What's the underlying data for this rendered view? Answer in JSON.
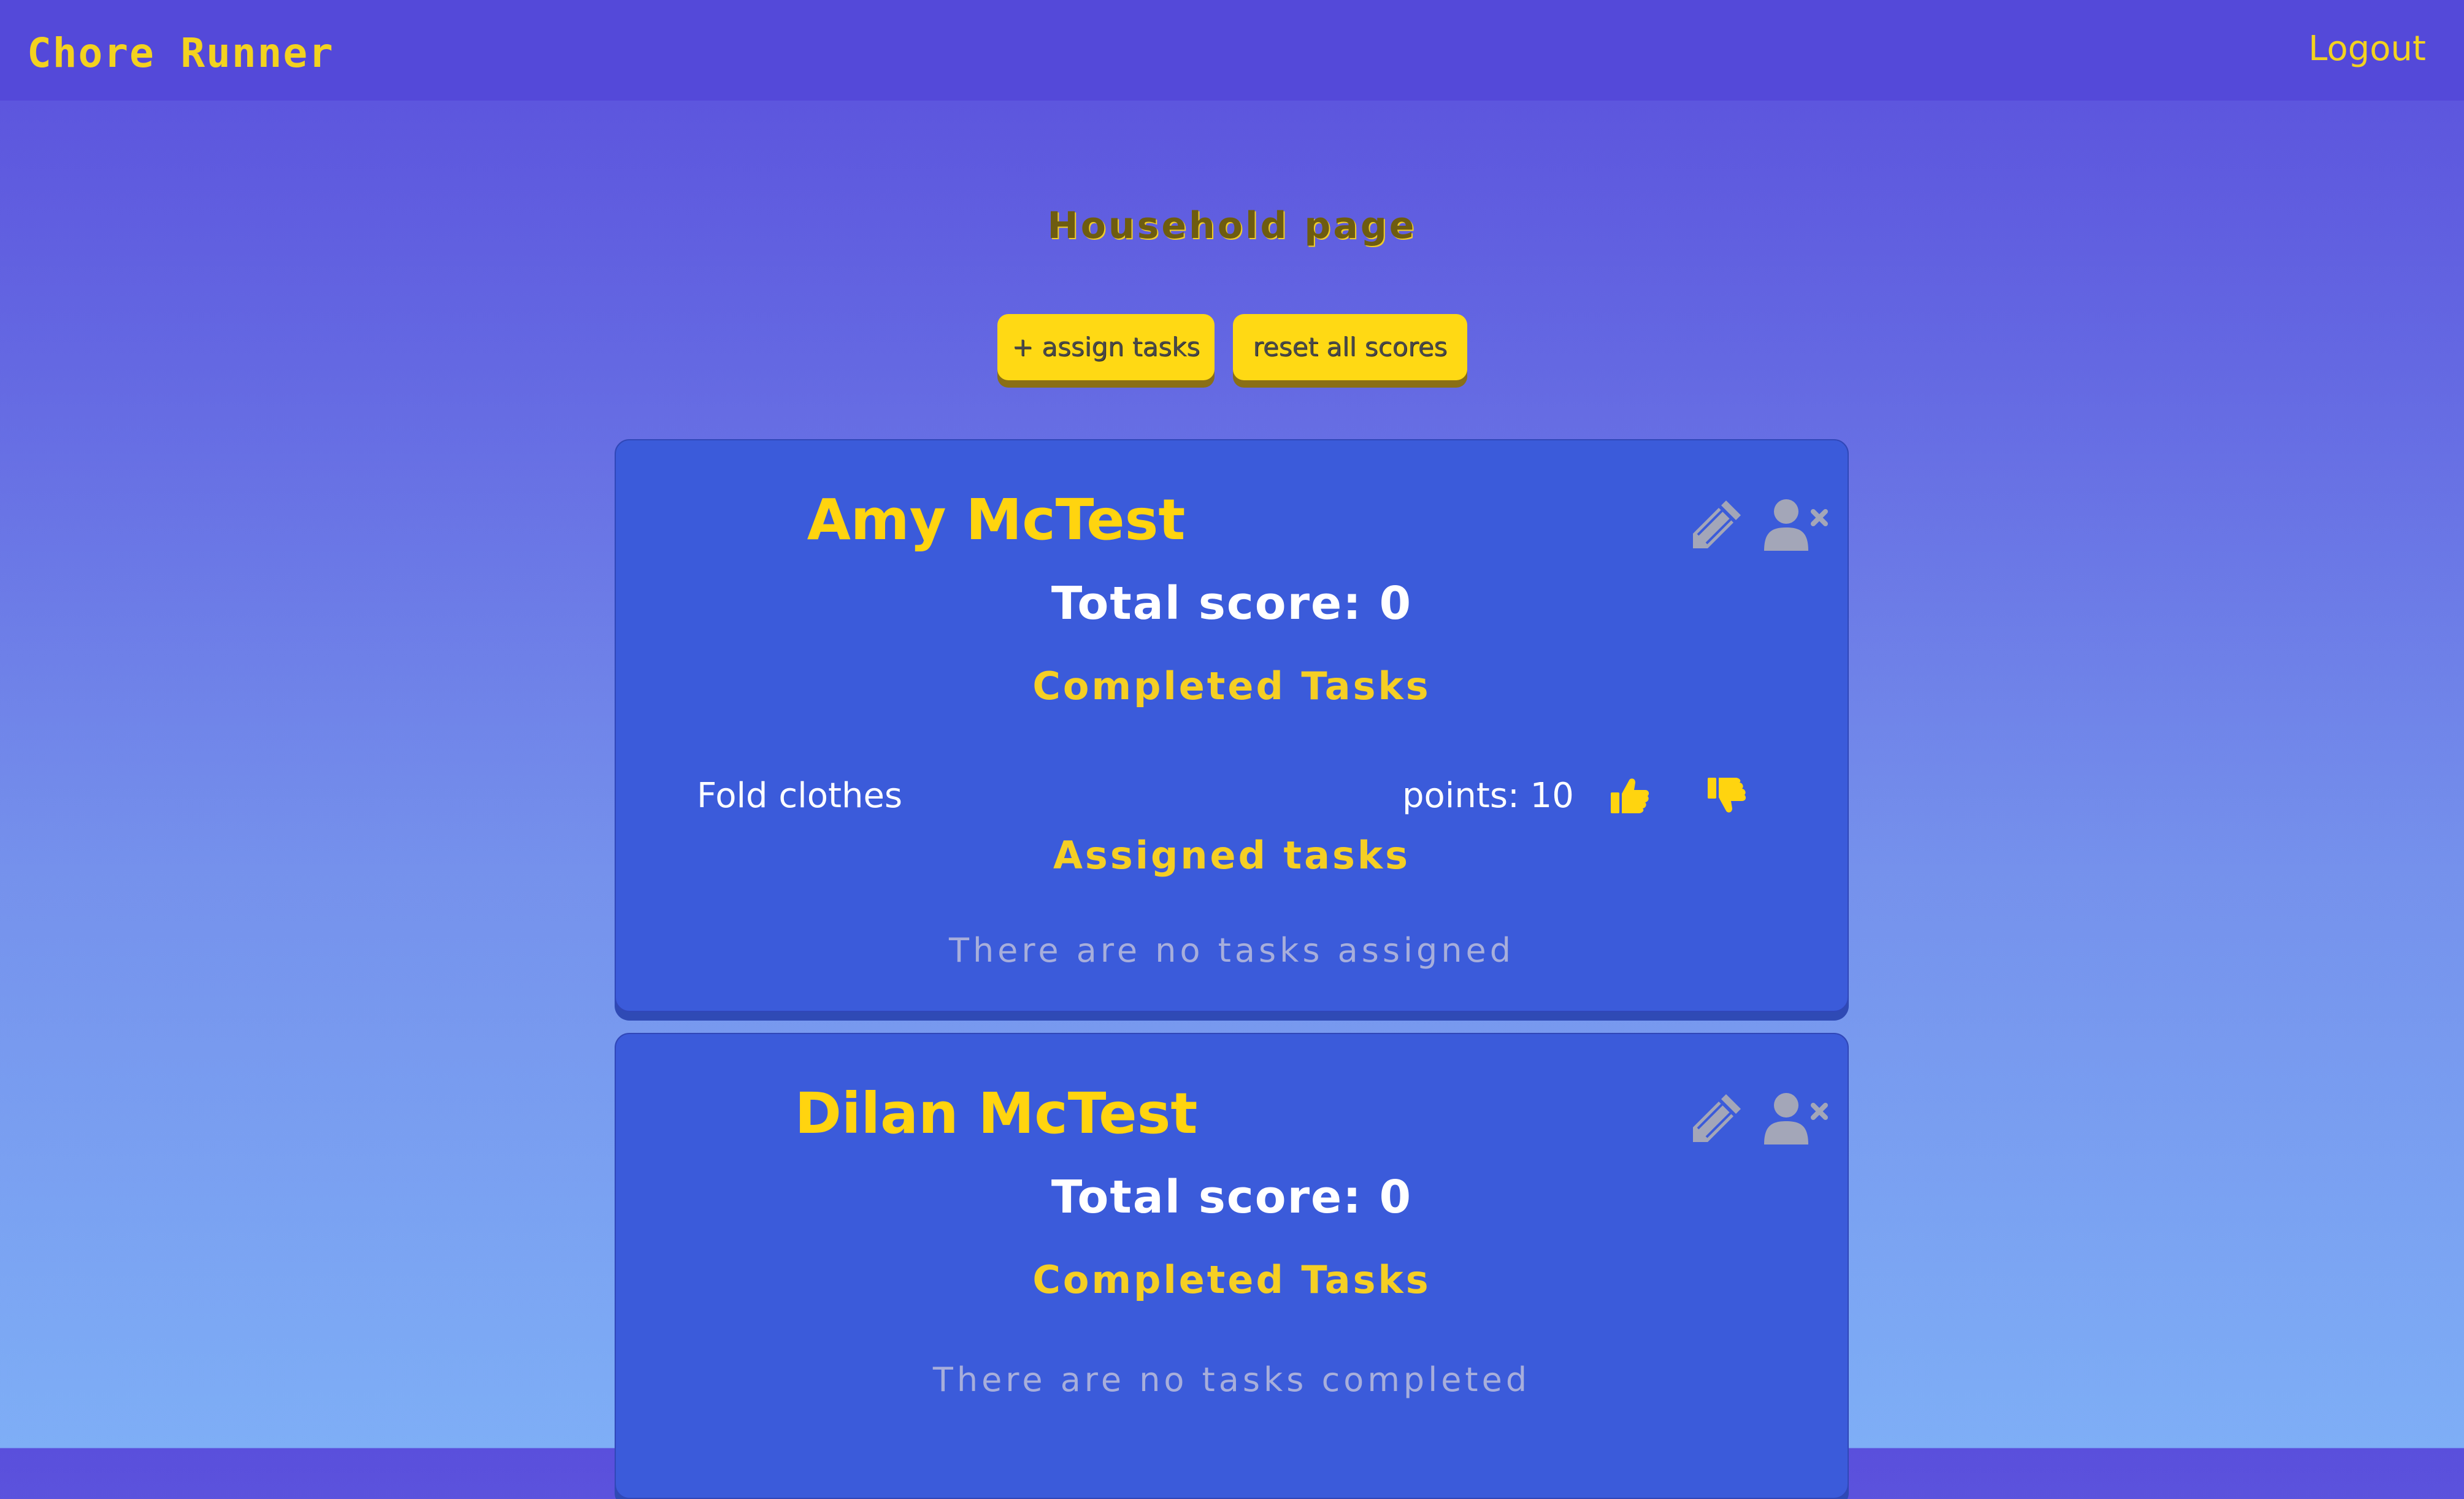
{
  "app": {
    "brand": "Chore Runner",
    "logout_label": "Logout"
  },
  "page": {
    "title": "Household page",
    "assign_button": "+ assign tasks",
    "reset_button": "reset all scores"
  },
  "members": [
    {
      "name": "Amy McTest",
      "total_score": "Total score: 0",
      "completed_heading": "Completed Tasks",
      "completed_tasks": [
        {
          "name": "Fold clothes",
          "points": "points: 10"
        }
      ],
      "assigned_heading": "Assigned tasks",
      "assigned_empty": "There are no tasks assigned"
    },
    {
      "name": "Dilan McTest",
      "total_score": "Total score: 0",
      "completed_heading": "Completed Tasks",
      "completed_empty": "There are no tasks completed"
    }
  ],
  "icons": {
    "edit": "pencil-icon",
    "remove_member": "user-remove-icon",
    "approve": "thumbs-up-icon",
    "reject": "thumbs-down-icon"
  },
  "colors": {
    "accent_yellow": "#ffd40f",
    "card_blue": "#3b5bda",
    "navbar": "#5449d9",
    "icon_gray": "#a3a6b8"
  }
}
